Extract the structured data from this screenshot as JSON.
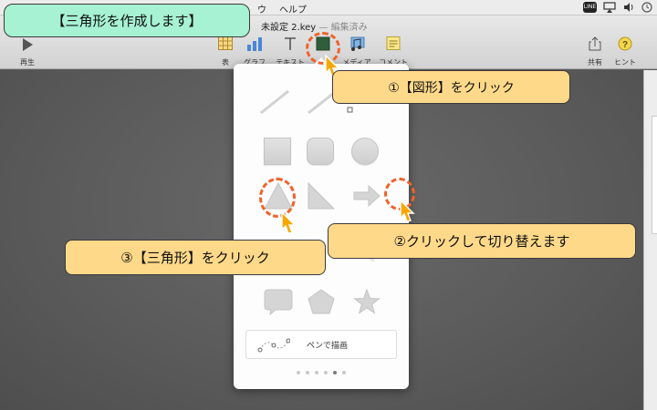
{
  "menubar": {
    "items": [
      "ウ",
      "ヘルプ"
    ],
    "line_badge": "LINE"
  },
  "window": {
    "title_prefix": "未設定 2.key",
    "title_suffix": " — 編集済み"
  },
  "toolbar": {
    "play_label": "再生",
    "table_label": "表",
    "chart_label": "グラフ",
    "text_label": "テキスト",
    "shape_label": "図形",
    "media_label": "メディア",
    "comment_label": "コメント",
    "share_label": "共有",
    "hint_label": "ヒント"
  },
  "popover": {
    "pen_label": "ペンで描画",
    "page_count": 6,
    "active_page": 5
  },
  "callouts": {
    "title": "【三角形を作成します】",
    "step1": "①【図形】をクリック",
    "step2": "②クリックして切り替えます",
    "step3": "③【三角形】をクリック"
  },
  "colors": {
    "callout_orange": "#ffd98a",
    "callout_green": "#a6f2d3",
    "ring": "#f0622a",
    "shape_icon": "#2f5f3a"
  }
}
